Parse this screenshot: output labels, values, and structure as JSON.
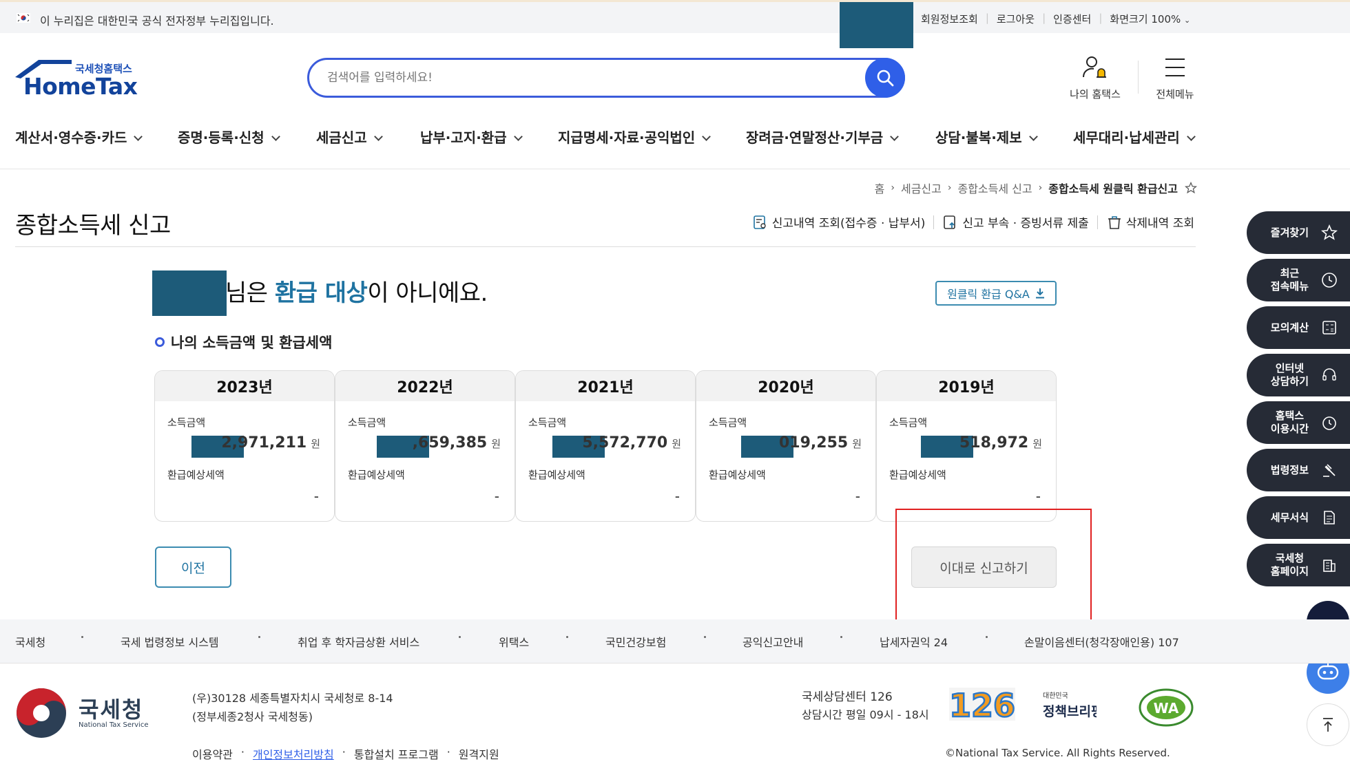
{
  "govbar": {
    "notice": "이 누리집은 대한민국 공식 전자정부 누리집입니다.",
    "links": [
      "회원정보조회",
      "로그아웃",
      "인증센터",
      "화면크기 100%"
    ]
  },
  "logo": {
    "sub": "국세청홈택스",
    "main": "HomeTax"
  },
  "search": {
    "placeholder": "검색어를 입력하세요!"
  },
  "header_icons": {
    "my": "나의 홈택스",
    "all_menu": "전체메뉴"
  },
  "gnb": [
    "계산서·영수증·카드",
    "증명·등록·신청",
    "세금신고",
    "납부·고지·환급",
    "지급명세·자료·공익법인",
    "장려금·연말정산·기부금",
    "상담·불복·제보",
    "세무대리·납세관리"
  ],
  "breadcrumb": [
    "홈",
    "세금신고",
    "종합소득세 신고",
    "종합소득세 원클릭 환급신고"
  ],
  "page_title": "종합소득세 신고",
  "title_tools": [
    "신고내역 조회(접수증 · 납부서)",
    "신고 부속 · 증빙서류 제출",
    "삭제내역 조회"
  ],
  "main": {
    "headline_pre": "님은 ",
    "headline_hl": "환급 대상",
    "headline_post": "이 아니에요.",
    "qa_button": "원클릭 환급 Q&A",
    "subhead": "나의 소득금액 및 환급세액",
    "income_label": "소득금액",
    "refund_label": "환급예상세액",
    "won": "원",
    "years": [
      {
        "year": "2023년",
        "income": "2,971,211",
        "refund": "-"
      },
      {
        "year": "2022년",
        "income": ",659,385",
        "refund": "-"
      },
      {
        "year": "2021년",
        "income": "5,572,770",
        "refund": "-"
      },
      {
        "year": "2020년",
        "income": "019,255",
        "refund": "-"
      },
      {
        "year": "2019년",
        "income": "518,972",
        "refund": "-"
      }
    ],
    "prev_button": "이전",
    "file_button": "이대로 신고하기"
  },
  "quick_menu": [
    "즐겨찾기",
    "최근\n접속메뉴",
    "모의계산",
    "인터넷\n상담하기",
    "홈택스\n이용시간",
    "법령정보",
    "세무서식",
    "국세청\n홈페이지"
  ],
  "footer": {
    "links": [
      "국세청",
      "국세 법령정보 시스템",
      "취업 후 학자금상환 서비스",
      "위택스",
      "국민건강보험",
      "공익신고안내",
      "납세자권익 24",
      "손말이음센터(청각장애인용) 107"
    ],
    "org_name": "국세청",
    "org_eng": "National Tax Service",
    "address1": "(우)30128 세종특별자치시 국세청로 8-14",
    "address2": "(정부세종2청사 국세청동)",
    "nav": [
      "이용약관",
      "개인정보처리방침",
      "통합설치 프로그램",
      "원격지원"
    ],
    "call_center": "국세상담센터 126",
    "hours": "상담시간 평일 09시 - 18시",
    "badge_126": "126",
    "policy_top": "대한민국",
    "policy_main": "정책브리핑",
    "wa_text": "WA",
    "copyright": "©National Tax Service. All Rights Reserved."
  },
  "colors": {
    "mask": "#1d5b79",
    "accent": "#1f73a1",
    "brand": "#12439b",
    "search": "#2f5fe8",
    "highlight_box": "#e02020"
  }
}
